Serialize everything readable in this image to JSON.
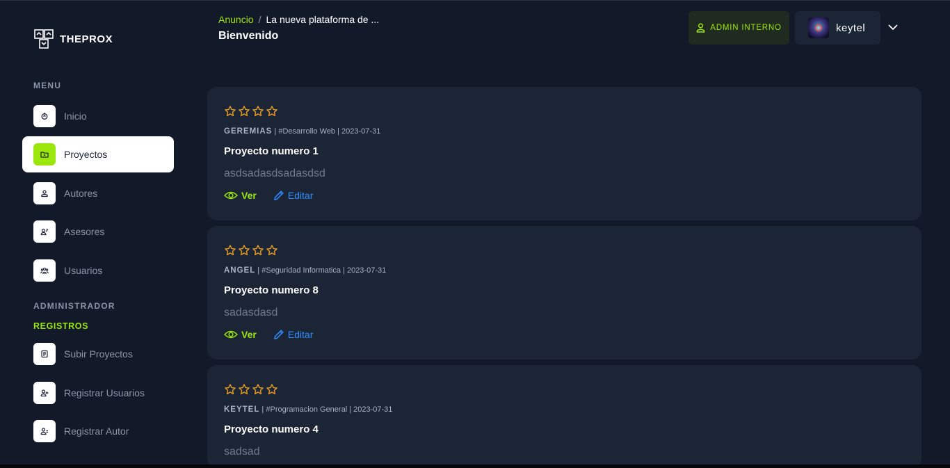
{
  "brand": {
    "name": "THEPROX"
  },
  "sidebar": {
    "menu_label": "MENU",
    "menu_items": [
      {
        "label": "Inicio",
        "icon": "home-icon",
        "active": false
      },
      {
        "label": "Proyectos",
        "icon": "folder-icon",
        "active": true
      },
      {
        "label": "Autores",
        "icon": "user-icon",
        "active": false
      },
      {
        "label": "Asesores",
        "icon": "advisor-icon",
        "active": false
      },
      {
        "label": "Usuarios",
        "icon": "users-icon",
        "active": false
      }
    ],
    "admin_label": "ADMINISTRADOR",
    "registros_label": "REGISTROS",
    "admin_items": [
      {
        "label": "Subir Proyectos",
        "icon": "upload-document-icon"
      },
      {
        "label": "Registrar Usuarios",
        "icon": "add-user-icon"
      },
      {
        "label": "Registrar Autor",
        "icon": "add-author-icon"
      }
    ]
  },
  "header": {
    "breadcrumb": {
      "link": "Anuncio",
      "separator": "/",
      "current": "La nueva plataforma de ..."
    },
    "title": "Bienvenido",
    "role_button": "ADMIN INTERNO",
    "username": "keytel"
  },
  "projects": [
    {
      "author": "GEREMIAS",
      "tag": "#Desarrollo Web",
      "date": "2023-07-31",
      "title": "Proyecto numero 1",
      "description": "asdsadasdsadasdsd",
      "rating": 0,
      "max_rating": 4,
      "view_label": "Ver",
      "edit_label": "Editar"
    },
    {
      "author": "ANGEL",
      "tag": "#Seguridad Informatica",
      "date": "2023-07-31",
      "title": "Proyecto numero 8",
      "description": "sadasdasd",
      "rating": 0,
      "max_rating": 4,
      "view_label": "Ver",
      "edit_label": "Editar"
    },
    {
      "author": "KEYTEL",
      "tag": "#Programacion General",
      "date": "2023-07-31",
      "title": "Proyecto numero 4",
      "description": "sadsad",
      "rating": 0,
      "max_rating": 4,
      "view_label": "Ver",
      "edit_label": "Editar"
    }
  ],
  "colors": {
    "accent": "#9be60d",
    "background": "#121a29",
    "card": "#1c2535",
    "star": "#f0a020",
    "link": "#2f8cff"
  }
}
